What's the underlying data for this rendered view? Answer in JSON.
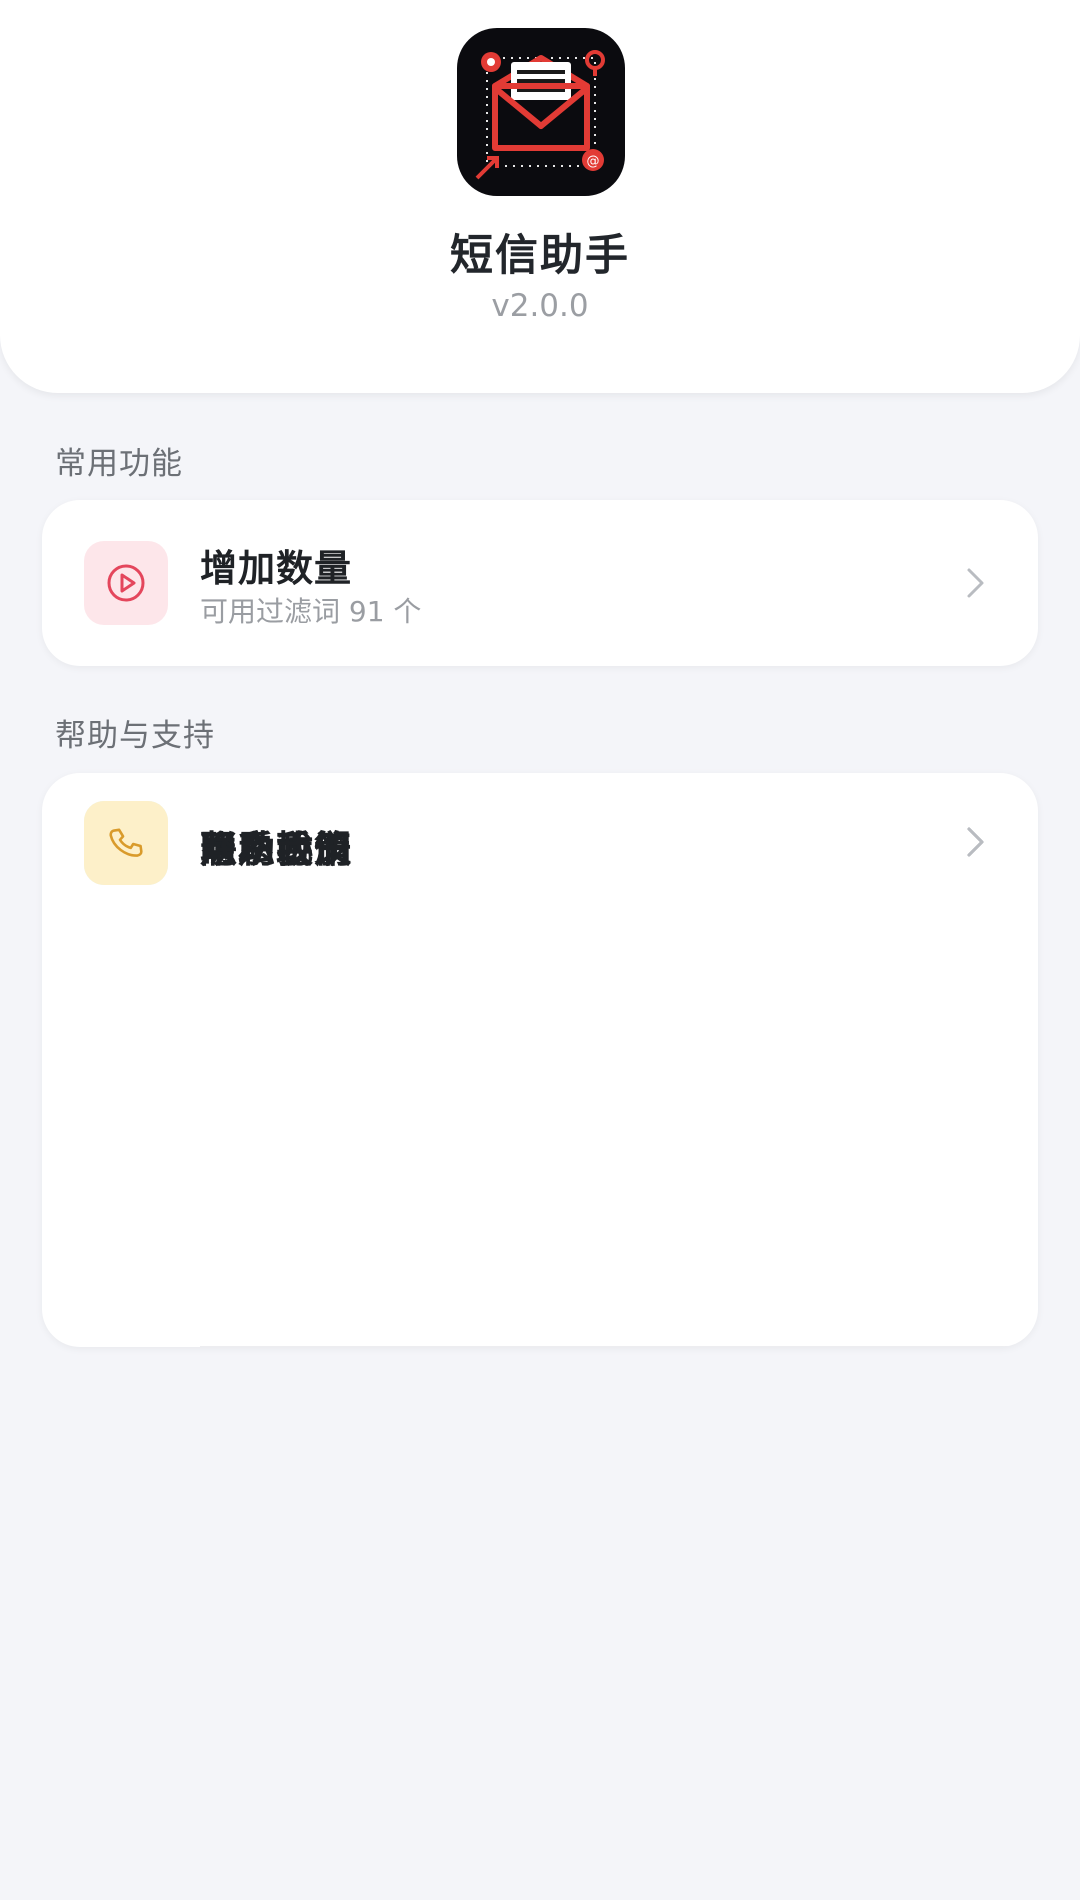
{
  "app": {
    "name": "短信助手",
    "version": "v2.0.0"
  },
  "sections": {
    "common": {
      "title": "常用功能",
      "items": [
        {
          "label": "增加数量",
          "subtitle": "可用过滤词 91 个",
          "icon": "play-circle-icon"
        }
      ]
    },
    "help": {
      "title": "帮助与支持",
      "items": [
        {
          "label": "隐私政策",
          "icon": "document-shield-icon"
        },
        {
          "label": "用户协议",
          "icon": "user-icon"
        },
        {
          "label": "帮助手册",
          "icon": "document-person-icon"
        },
        {
          "label": "联系我们",
          "icon": "phone-icon"
        }
      ]
    }
  },
  "colors": {
    "background": "#f4f5f9",
    "card": "#ffffff",
    "play_icon": "#e4465c",
    "play_icon_bg": "#fde6ea",
    "privacy_icon": "#2d8ed4",
    "privacy_icon_bg": "#e3f2fd",
    "user_icon": "#25859a",
    "user_icon_bg": "#edf6fc",
    "manual_icon": "#2fb47e",
    "manual_icon_bg": "#e9f8f1",
    "phone_icon": "#d99b2b",
    "phone_icon_bg": "#fdf0c9"
  }
}
